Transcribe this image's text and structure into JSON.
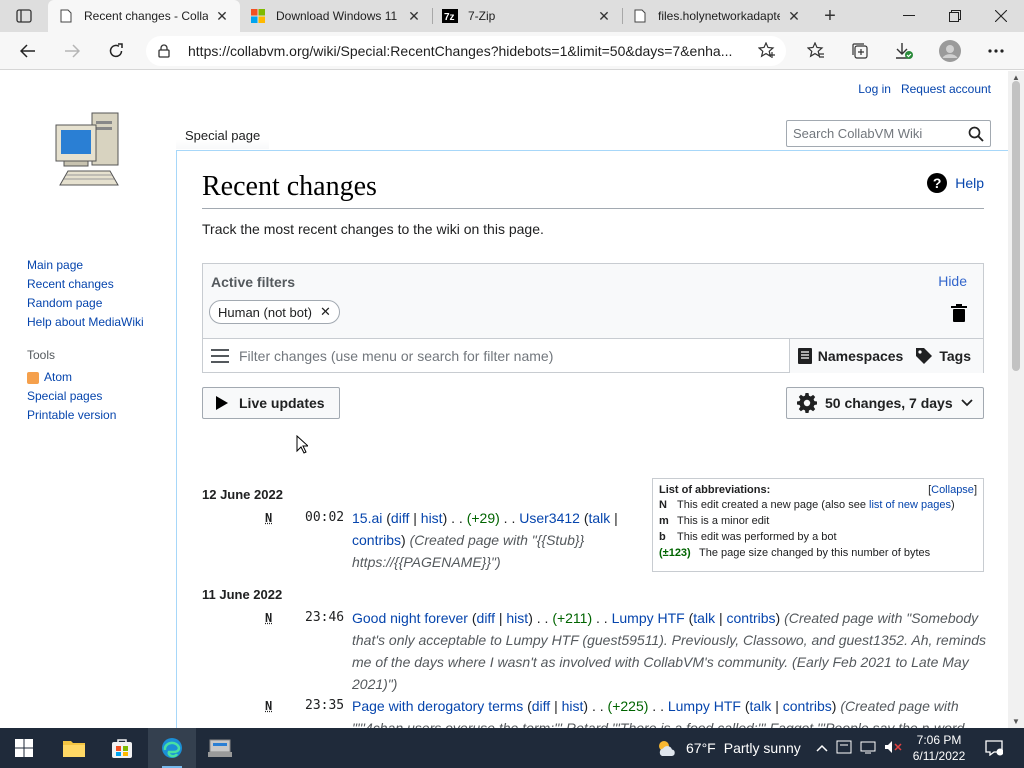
{
  "browser": {
    "tabs": [
      {
        "title": "Recent changes - CollabVM Wiki",
        "favicon": "page-icon"
      },
      {
        "title": "Download Windows 11",
        "favicon": "microsoft-logo-icon"
      },
      {
        "title": "7-Zip",
        "favicon": "7zip-icon"
      },
      {
        "title": "files.holynetworkadapter",
        "favicon": "page-icon"
      }
    ],
    "url": "https://collabvm.org/wiki/Special:RecentChanges?hidebots=1&limit=50&days=7&enha..."
  },
  "wiki": {
    "personal": {
      "login": "Log in",
      "request": "Request account"
    },
    "namespace_tab": "Special page",
    "search_placeholder": "Search CollabVM Wiki",
    "nav": [
      "Main page",
      "Recent changes",
      "Random page",
      "Help about MediaWiki"
    ],
    "tools": {
      "heading": "Tools",
      "items": [
        "Atom",
        "Special pages",
        "Printable version"
      ]
    },
    "title": "Recent changes",
    "help": "Help",
    "intro": "Track the most recent changes to the wiki on this page.",
    "filters": {
      "title": "Active filters",
      "hide": "Hide",
      "chip": "Human (not bot)",
      "placeholder": "Filter changes (use menu or search for filter name)",
      "namespaces": "Namespaces",
      "tags": "Tags"
    },
    "live_updates": "Live updates",
    "changes_setting": "50 changes, 7 days",
    "abbreviations": {
      "title": "List of abbreviations:",
      "collapse": "Collapse",
      "rows": [
        {
          "key": "N",
          "text": "This edit created a new page (also see ",
          "link": "list of new pages",
          "tail": ")"
        },
        {
          "key": "m",
          "text": "This is a minor edit"
        },
        {
          "key": "b",
          "text": "This edit was performed by a bot"
        },
        {
          "key": "(±123)",
          "text": "The page size changed by this number of bytes"
        }
      ]
    },
    "days": [
      {
        "date": "12 June 2022",
        "entries": [
          {
            "flag": "N",
            "time": "00:02",
            "page": "15.ai",
            "diff": "diff",
            "hist": "hist",
            "size": "(+29)",
            "user": "User3412",
            "talk": "talk",
            "contribs": "contribs",
            "comment": "(Created page with \"{{Stub}} https://{{PAGENAME}}\")"
          }
        ]
      },
      {
        "date": "11 June 2022",
        "entries": [
          {
            "flag": "N",
            "time": "23:46",
            "page": "Good night forever",
            "diff": "diff",
            "hist": "hist",
            "size": "(+211)",
            "user": "Lumpy HTF",
            "talk": "talk",
            "contribs": "contribs",
            "comment": "(Created page with \"Somebody that's only acceptable to Lumpy HTF (guest59511). Previously, Classowo, and guest1352. Ah, reminds me of the days where I wasn't as involved with CollabVM's community. (Early Feb 2021 to Late May 2021)\")"
          },
          {
            "flag": "N",
            "time": "23:35",
            "page": "Page with derogatory terms",
            "diff": "diff",
            "hist": "hist",
            "size": "(+225)",
            "user": "Lumpy HTF",
            "talk": "talk",
            "contribs": "contribs",
            "comment": "(Created page with \"'''4chan users overuse the term:''' Retard '''There is a food called:''' Faggot '''People say the n-word"
          }
        ]
      }
    ]
  },
  "taskbar": {
    "weather_temp": "67°F",
    "weather_desc": "Partly sunny",
    "time": "7:06 PM",
    "date": "6/11/2022"
  }
}
